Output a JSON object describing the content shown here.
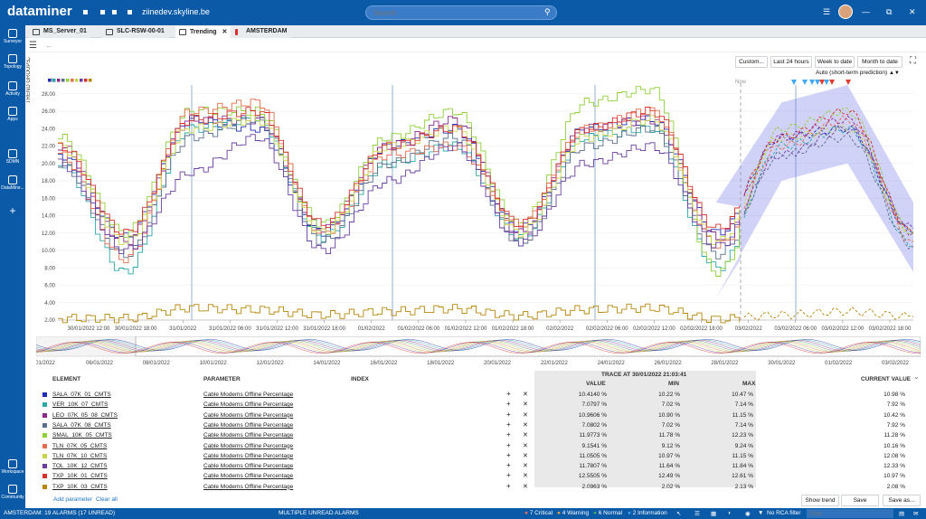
{
  "app": {
    "brand": "dataminer",
    "host": "ziinedev.skyline.be",
    "search_placeholder": "Search"
  },
  "sidebar": [
    {
      "label": "Surveyor",
      "icon": "surveyor-icon"
    },
    {
      "label": "Topology",
      "icon": "topology-icon"
    },
    {
      "label": "Activity",
      "icon": "activity-icon"
    },
    {
      "label": "Apps",
      "icon": "apps-icon"
    },
    {
      "label": "SDMN",
      "icon": "sdmn-icon"
    },
    {
      "label": "DataMine...",
      "icon": "dataminer-icon"
    },
    {
      "label": "+",
      "icon": "plus-icon"
    },
    {
      "label": "Workspace",
      "icon": "workspace-icon"
    },
    {
      "label": "Community",
      "icon": "community-icon"
    }
  ],
  "tabs": [
    {
      "label": "MS_Server_01",
      "icon": "element-icon"
    },
    {
      "label": "SLC-RSW-00-01",
      "icon": "element-icon"
    },
    {
      "label": "Trending",
      "icon": "trend-icon",
      "active": true
    },
    {
      "label": "AMSTERDAM",
      "icon": "view-icon"
    }
  ],
  "trend_groups_label": "TREND GROUPS",
  "range_buttons": [
    "Custom...",
    "Last 24 hours",
    "Week to date",
    "Month to date"
  ],
  "prediction_label": "Auto (short-term prediction)",
  "chart_data": {
    "type": "line",
    "y_unit": "%",
    "ylim": [
      2,
      29
    ],
    "y_ticks": [
      "2.00",
      "4.00",
      "6.00",
      "8.00",
      "10.00",
      "12.00",
      "14.00",
      "16.00",
      "18.00",
      "20.00",
      "22.00",
      "24.00",
      "26.00",
      "28.00"
    ],
    "x_ticks": [
      "30/01/2022 12:00",
      "30/01/2022 18:00",
      "31/01/2022",
      "31/01/2022 06:00",
      "31/01/2022 12:00",
      "31/01/2022 18:00",
      "01/02/2022",
      "01/02/2022 06:00",
      "01/02/2022 12:00",
      "01/02/2022 18:00",
      "02/02/2022",
      "02/02/2022 06:00",
      "02/02/2022 12:00",
      "02/02/2022 18:00",
      "03/02/2022",
      "03/02/2022 06:00",
      "03/02/2022 12:00",
      "03/02/2022 18:00"
    ],
    "now_label": "Now",
    "grid": true,
    "series_profile": {
      "description_points_x": [
        "30/01 06:00",
        "30/01 18:00",
        "31/01 06:00",
        "31/01 12:00",
        "31/01 18:00",
        "01/02 06:00",
        "01/02 12:00",
        "01/02 18:00",
        "02/02 06:00",
        "02/02 12:00",
        "02/02 21:00",
        "03/02 06:00",
        "03/02 12:00",
        "03/02 18:00"
      ]
    },
    "series": [
      {
        "name": "SALA_07K_01_CMTS",
        "color": "#1f2db5",
        "values": [
          21,
          11.5,
          25,
          24,
          12,
          22,
          24,
          12.5,
          24,
          25,
          12.0,
          23,
          24,
          12
        ]
      },
      {
        "name": "VER_10K_07_CMTS",
        "color": "#2aa7a7",
        "values": [
          20,
          7.5,
          24,
          25,
          11.5,
          20,
          22,
          11.5,
          23,
          24,
          8.0,
          22,
          24,
          10.5
        ]
      },
      {
        "name": "LEO_07K_05_08_CMTS",
        "color": "#8a2a8a",
        "values": [
          22,
          11,
          25,
          25,
          12.5,
          22,
          25,
          12,
          24,
          25,
          11.5,
          23,
          25,
          12
        ]
      },
      {
        "name": "SALA_07K_08_CMTS",
        "color": "#5b6e8c",
        "values": [
          20,
          9.5,
          23,
          25,
          11,
          20,
          23,
          11,
          22,
          24,
          9.5,
          21,
          23,
          10.5
        ]
      },
      {
        "name": "SMAL_10K_05_CMTS",
        "color": "#8fcf3a",
        "values": [
          23,
          12,
          26,
          26,
          13,
          23,
          26,
          13,
          27,
          28.5,
          7.5,
          24,
          26,
          12
        ]
      },
      {
        "name": "TLN_07K_05_CMTS",
        "color": "#e36b4e",
        "values": [
          21,
          9,
          26,
          27,
          12,
          21,
          22,
          13,
          24,
          26,
          10.5,
          22,
          25,
          11
        ]
      },
      {
        "name": "TLN_07K_10_CMTS",
        "color": "#c9d64a",
        "values": [
          22,
          11,
          24,
          25,
          12,
          22,
          24,
          12,
          23,
          25,
          11,
          23,
          24,
          12
        ]
      },
      {
        "name": "TOL_10K_12_CMTS",
        "color": "#6a3ea0",
        "values": [
          20,
          10,
          19,
          23,
          10,
          18,
          22,
          11,
          20,
          22,
          10.5,
          21,
          24,
          12.5
        ]
      },
      {
        "name": "TXP_10K_01_CMTS",
        "color": "#d6302d",
        "values": [
          22,
          12,
          25,
          26,
          13,
          22,
          24,
          13,
          24,
          26,
          12.5,
          23,
          26,
          12
        ]
      },
      {
        "name": "TXP_10K_03_CMTS",
        "color": "#b8860b",
        "values": [
          2.2,
          2.2,
          3.4,
          3.2,
          2.6,
          3.0,
          3.3,
          2.5,
          3.2,
          3.4,
          2.1,
          2.6,
          3.0,
          2.4
        ]
      }
    ],
    "overview_ticks": [
      "01/2022",
      "06/01/2022",
      "08/01/2022",
      "10/01/2022",
      "12/01/2022",
      "14/01/2022",
      "16/01/2022",
      "18/01/2022",
      "20/01/2022",
      "22/01/2022",
      "24/01/2022",
      "26/01/2022",
      "28/01/2022",
      "30/01/2022",
      "01/02/2022",
      "03/02/2022"
    ]
  },
  "table": {
    "headers": {
      "element": "ELEMENT",
      "parameter": "PARAMETER",
      "index": "INDEX",
      "trace": "TRACE AT 30/01/2022 21:03:41",
      "value": "VALUE",
      "min": "MIN",
      "max": "MAX",
      "current": "CURRENT VALUE"
    },
    "rows": [
      {
        "element": "SALA_07K_01_CMTS",
        "parameter": "Cable Modems Offline Percentage",
        "value": "10.4140 %",
        "min": "10.22 %",
        "max": "10.47 %",
        "current": "10.98 %",
        "color": "#1f2db5"
      },
      {
        "element": "VER_10K_07_CMTS",
        "parameter": "Cable Modems Offline Percentage",
        "value": "7.0797 %",
        "min": "7.02 %",
        "max": "7.14 %",
        "current": "7.92 %",
        "color": "#2aa7a7"
      },
      {
        "element": "LEO_07K_05_08_CMTS",
        "parameter": "Cable Modems Offline Percentage",
        "value": "10.9606 %",
        "min": "10.90 %",
        "max": "11.15 %",
        "current": "10.42 %",
        "color": "#8a2a8a"
      },
      {
        "element": "SALA_07K_08_CMTS",
        "parameter": "Cable Modems Offline Percentage",
        "value": "7.0802 %",
        "min": "7.02 %",
        "max": "7.14 %",
        "current": "7.92 %",
        "color": "#5b6e8c"
      },
      {
        "element": "SMAL_10K_05_CMTS",
        "parameter": "Cable Modems Offline Percentage",
        "value": "11.9773 %",
        "min": "11.78 %",
        "max": "12.23 %",
        "current": "11.28 %",
        "color": "#8fcf3a"
      },
      {
        "element": "TLN_07K_05_CMTS",
        "parameter": "Cable Modems Offline Percentage",
        "value": "9.1541 %",
        "min": "9.12 %",
        "max": "9.24 %",
        "current": "10.16 %",
        "color": "#e36b4e"
      },
      {
        "element": "TLN_07K_10_CMTS",
        "parameter": "Cable Modems Offline Percentage",
        "value": "11.0505 %",
        "min": "10.97 %",
        "max": "11.15 %",
        "current": "12.08 %",
        "color": "#c9d64a"
      },
      {
        "element": "TOL_10K_12_CMTS",
        "parameter": "Cable Modems Offline Percentage",
        "value": "11.7807 %",
        "min": "11.64 %",
        "max": "11.84 %",
        "current": "12.33 %",
        "color": "#6a3ea0"
      },
      {
        "element": "TXP_10K_01_CMTS",
        "parameter": "Cable Modems Offline Percentage",
        "value": "12.5505 %",
        "min": "12.49 %",
        "max": "12.61 %",
        "current": "10.97 %",
        "color": "#d6302d"
      },
      {
        "element": "TXP_10K_03_CMTS",
        "parameter": "Cable Modems Offline Percentage",
        "value": "2.0963 %",
        "min": "2.02 %",
        "max": "2.13 %",
        "current": "2.08 %",
        "color": "#b8860b"
      }
    ],
    "add_parameter": "Add parameter",
    "clear_all": "Clear all",
    "buttons": [
      "Show trend",
      "Save",
      "Save as..."
    ]
  },
  "status": {
    "left": "AMSTERDAM: 19 ALARMS (17 UNREAD)",
    "center": "MULTIPLE UNREAD ALARMS",
    "critical": "7 Critical",
    "warning": "4 Warning",
    "normal": "6 Normal",
    "information": "2 Information",
    "rca": "No RCA filter",
    "filter_placeholder": "Filter",
    "colors": {
      "critical": "#e03c31",
      "warning": "#f0a030",
      "normal": "#4caf50",
      "information": "#3fa9f5"
    }
  }
}
